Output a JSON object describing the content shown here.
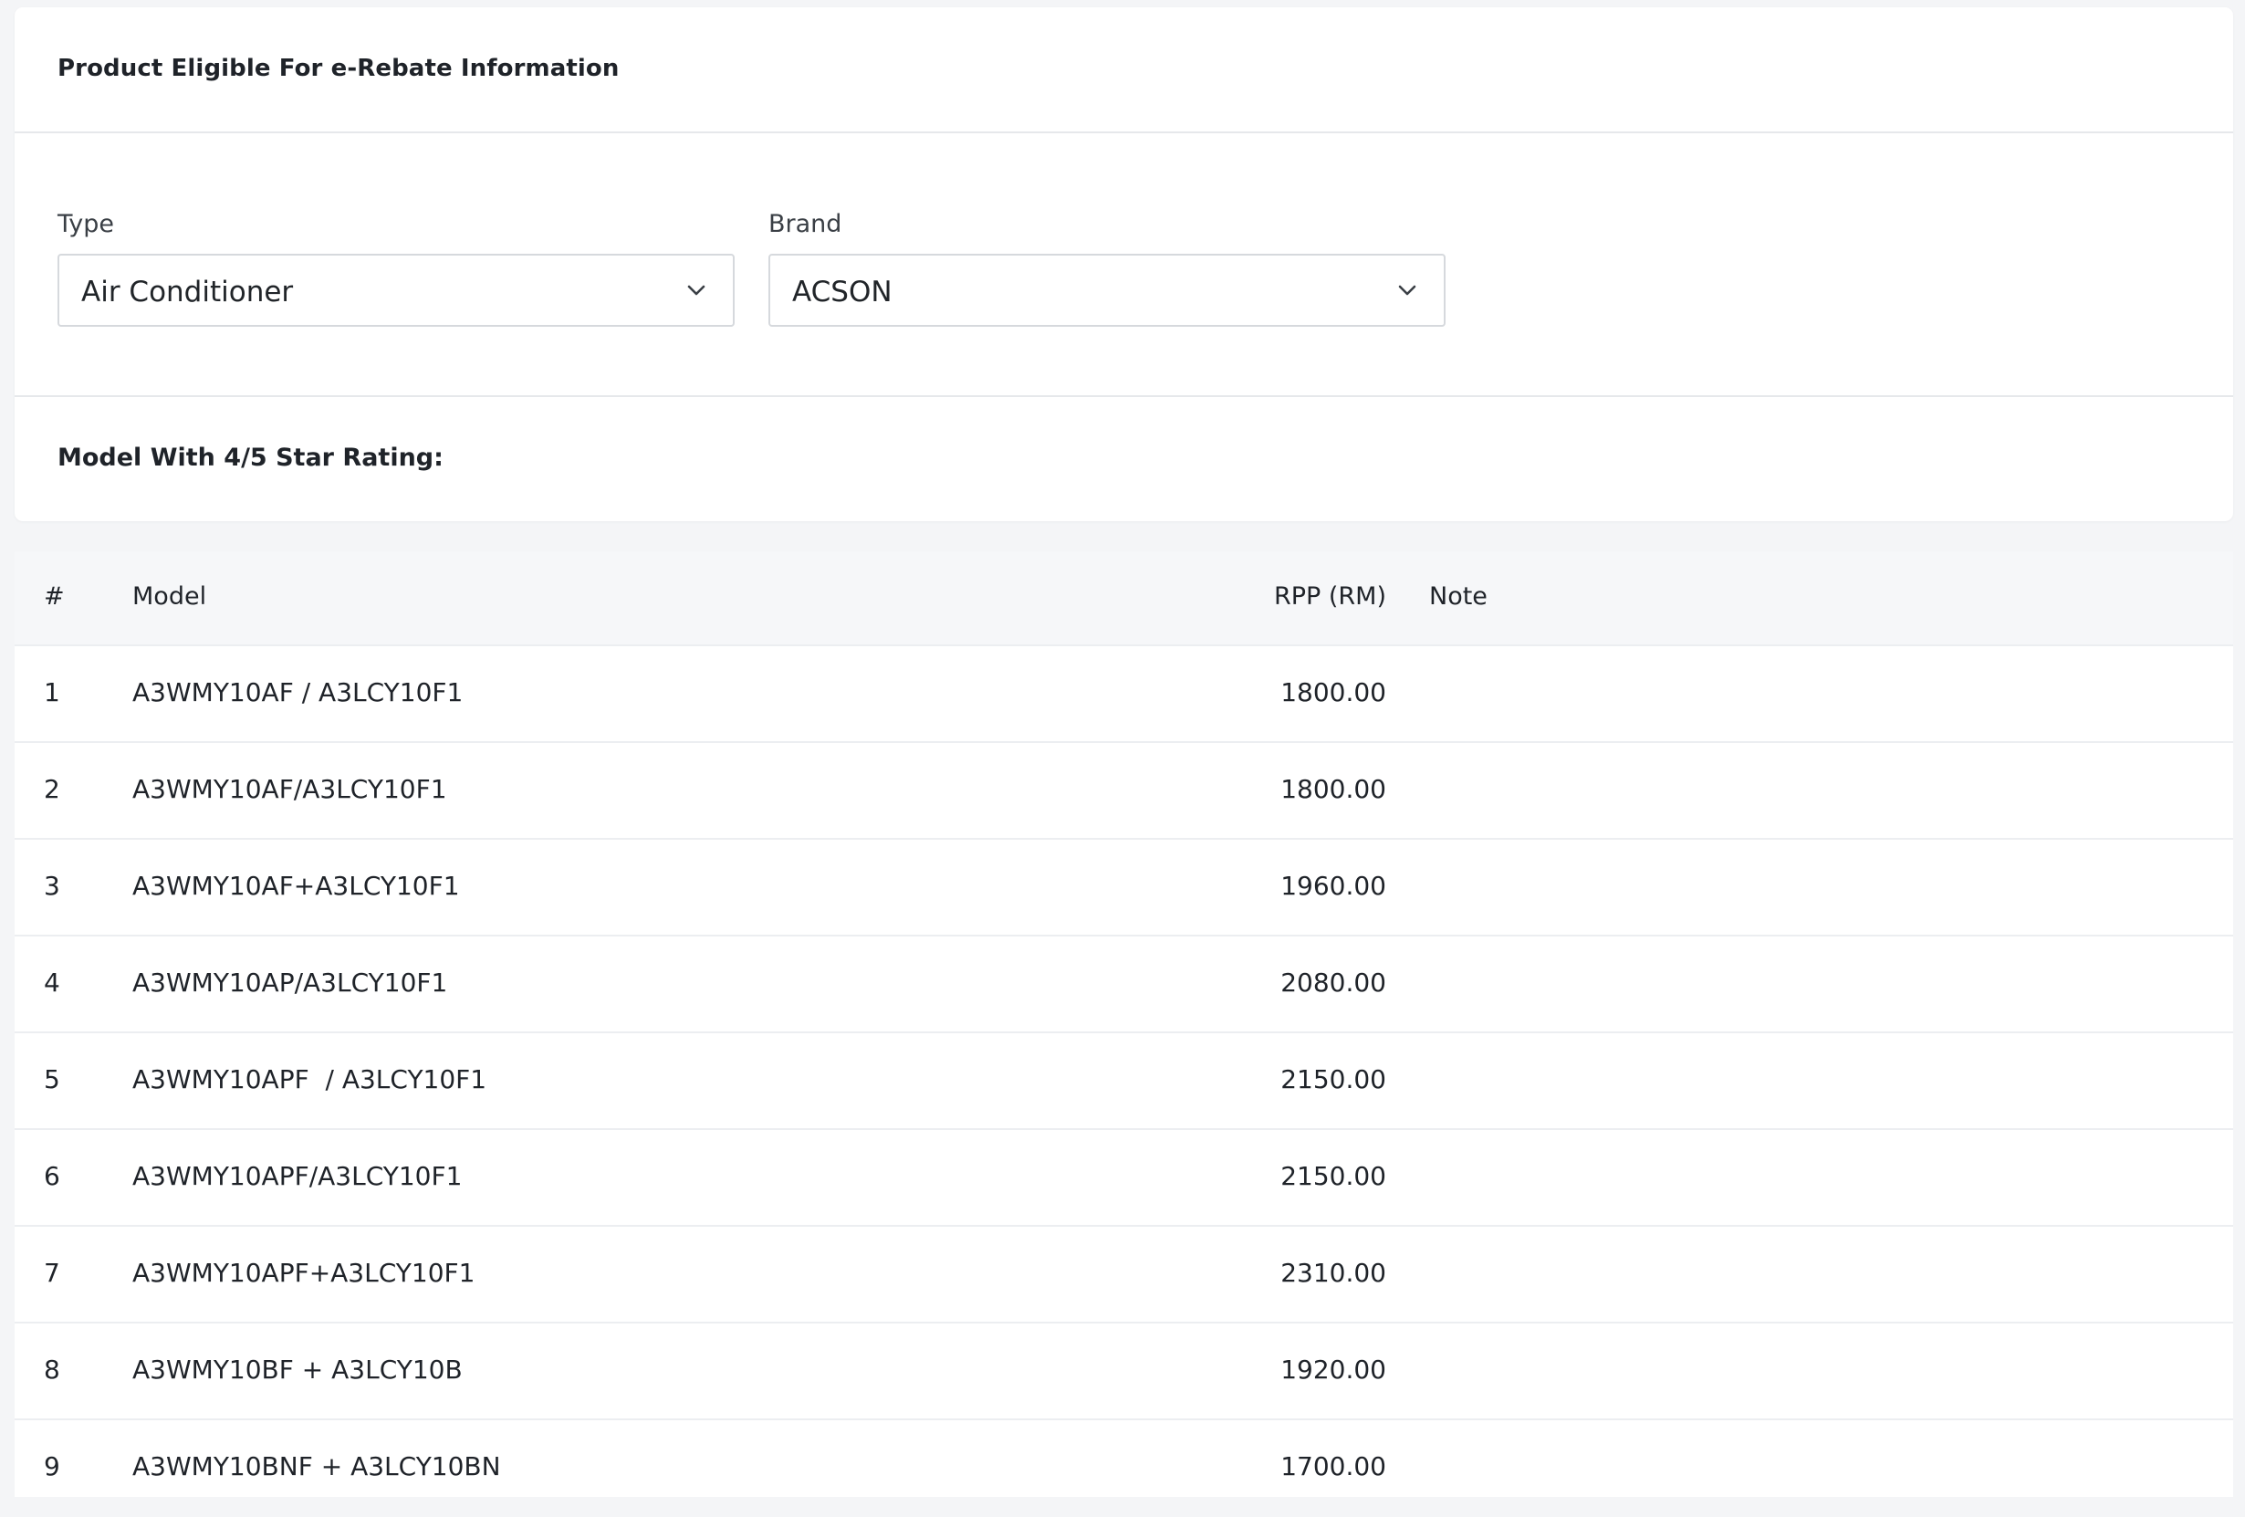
{
  "card": {
    "title": "Product Eligible For e-Rebate Information",
    "section_label": "Model With 4/5 Star Rating:"
  },
  "filters": {
    "type": {
      "label": "Type",
      "value": "Air Conditioner",
      "icon": "chevron-down-icon"
    },
    "brand": {
      "label": "Brand",
      "value": "ACSON",
      "icon": "chevron-down-icon"
    }
  },
  "table": {
    "headers": {
      "num": "#",
      "model": "Model",
      "rpp": "RPP (RM)",
      "note": "Note"
    },
    "rows": [
      {
        "num": "1",
        "model": "A3WMY10AF / A3LCY10F1",
        "rpp": "1800.00",
        "note": ""
      },
      {
        "num": "2",
        "model": "A3WMY10AF/A3LCY10F1",
        "rpp": "1800.00",
        "note": ""
      },
      {
        "num": "3",
        "model": "A3WMY10AF+A3LCY10F1",
        "rpp": "1960.00",
        "note": ""
      },
      {
        "num": "4",
        "model": "A3WMY10AP/A3LCY10F1",
        "rpp": "2080.00",
        "note": ""
      },
      {
        "num": "5",
        "model": "A3WMY10APF  / A3LCY10F1",
        "rpp": "2150.00",
        "note": ""
      },
      {
        "num": "6",
        "model": "A3WMY10APF/A3LCY10F1",
        "rpp": "2150.00",
        "note": ""
      },
      {
        "num": "7",
        "model": "A3WMY10APF+A3LCY10F1",
        "rpp": "2310.00",
        "note": ""
      },
      {
        "num": "8",
        "model": "A3WMY10BF + A3LCY10B",
        "rpp": "1920.00",
        "note": ""
      },
      {
        "num": "9",
        "model": "A3WMY10BNF + A3LCY10BN",
        "rpp": "1700.00",
        "note": ""
      }
    ]
  }
}
